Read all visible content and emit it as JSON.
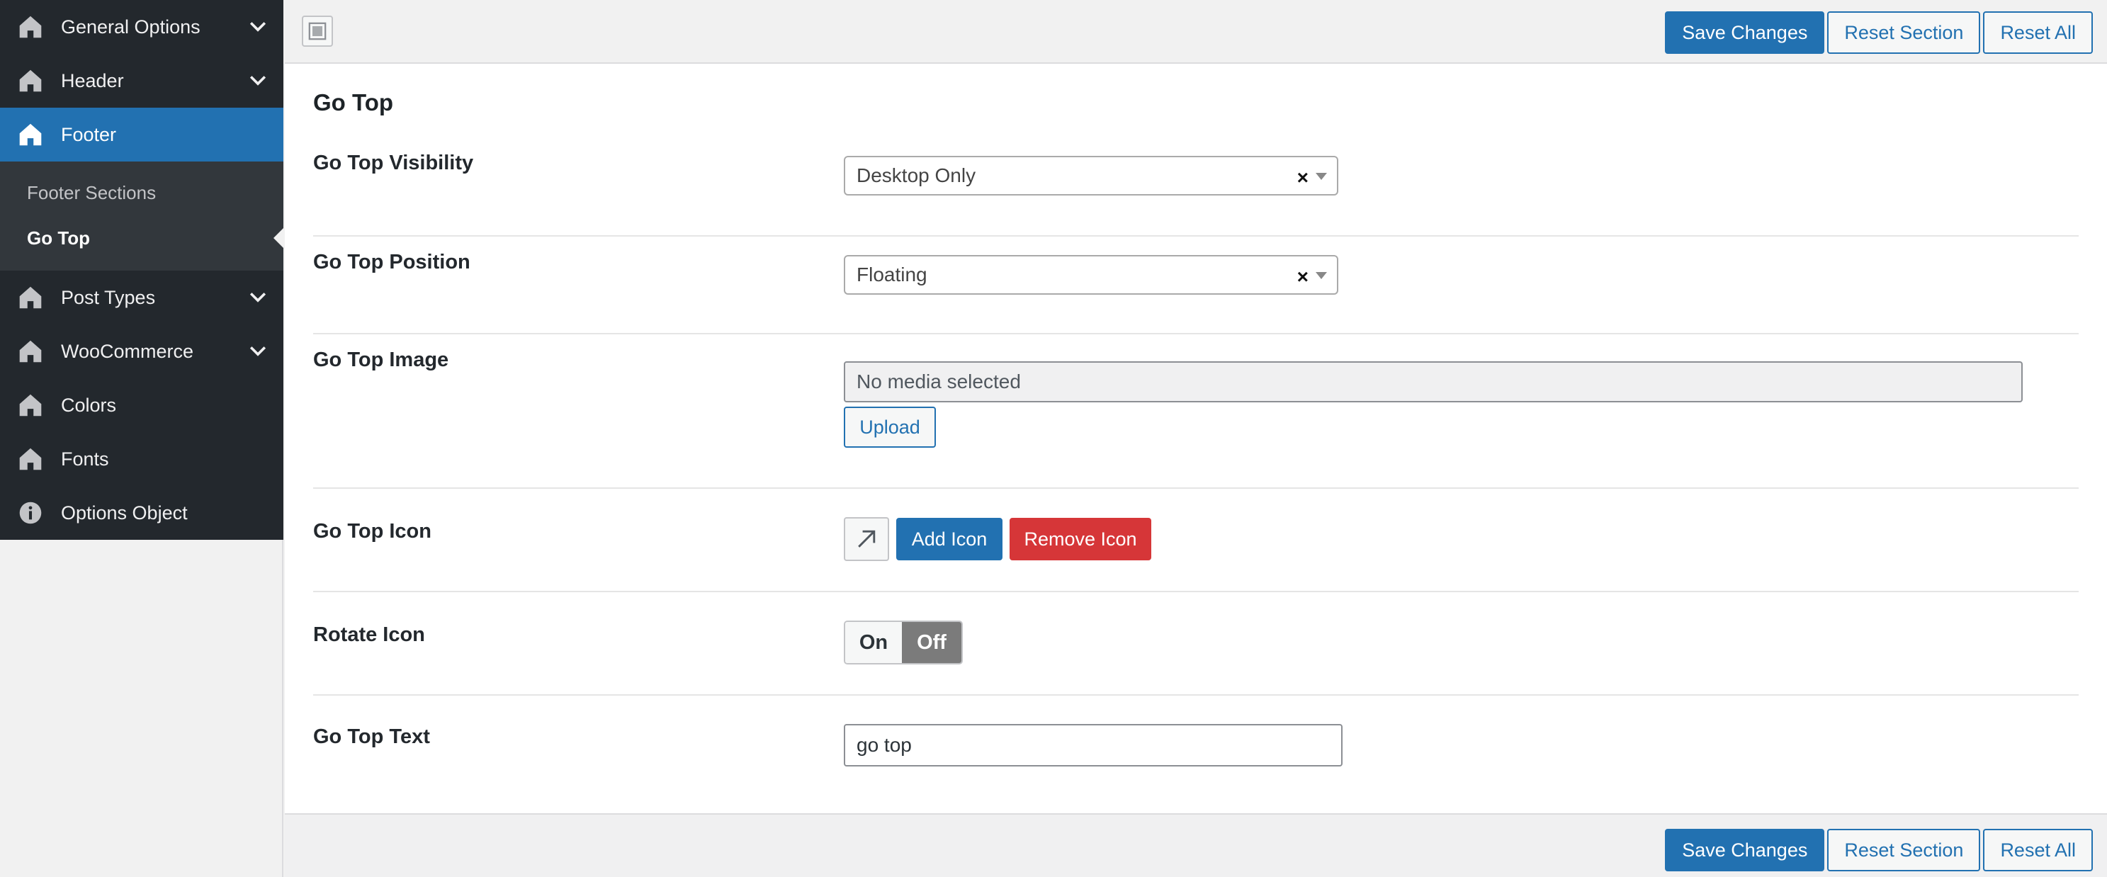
{
  "sidebar": {
    "items": [
      {
        "label": "General Options",
        "icon": "home-icon",
        "expandable": true
      },
      {
        "label": "Header",
        "icon": "home-icon",
        "expandable": true
      },
      {
        "label": "Footer",
        "icon": "home-icon",
        "active": true
      },
      {
        "label": "Post Types",
        "icon": "home-icon",
        "expandable": true
      },
      {
        "label": "WooCommerce",
        "icon": "home-icon",
        "expandable": true
      },
      {
        "label": "Colors",
        "icon": "home-icon"
      },
      {
        "label": "Fonts",
        "icon": "home-icon"
      },
      {
        "label": "Options Object",
        "icon": "info-icon"
      }
    ],
    "footer_submenu": [
      {
        "label": "Footer Sections"
      },
      {
        "label": "Go Top",
        "current": true
      }
    ]
  },
  "toolbar": {
    "save_label": "Save Changes",
    "reset_section_label": "Reset Section",
    "reset_all_label": "Reset All"
  },
  "section": {
    "title": "Go Top",
    "fields": {
      "visibility": {
        "label": "Go Top Visibility",
        "value": "Desktop Only"
      },
      "position": {
        "label": "Go Top Position",
        "value": "Floating"
      },
      "image": {
        "label": "Go Top Image",
        "placeholder": "No media selected",
        "upload_label": "Upload"
      },
      "icon": {
        "label": "Go Top Icon",
        "add_label": "Add Icon",
        "remove_label": "Remove Icon",
        "preview_icon": "arrow-up-right-icon"
      },
      "rotate": {
        "label": "Rotate Icon",
        "on_label": "On",
        "off_label": "Off",
        "value": "Off"
      },
      "text": {
        "label": "Go Top Text",
        "value": "go top"
      }
    }
  },
  "colors": {
    "sidebar_bg": "#23282d",
    "active_bg": "#2271b1",
    "primary": "#2271b1",
    "danger": "#d63638"
  }
}
